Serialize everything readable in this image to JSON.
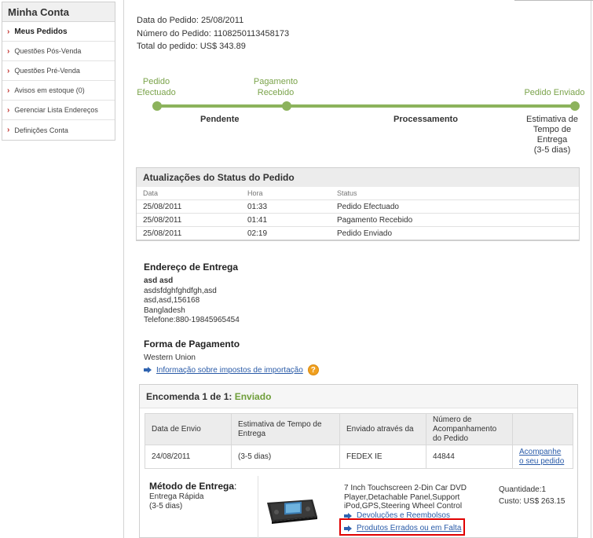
{
  "sidebar": {
    "title": "Minha Conta",
    "items": [
      {
        "label": "Meus Pedidos"
      },
      {
        "label": "Questões Pós-Venda"
      },
      {
        "label": "Questões Pré-Venda"
      },
      {
        "label": "Avisos em estoque (0)"
      },
      {
        "label": "Gerenciar Lista Endereços"
      },
      {
        "label": "Definições Conta"
      }
    ]
  },
  "order": {
    "date_line": "Data do Pedido: 25/08/2011",
    "number_line": "Número do Pedido: 1108250113458173",
    "total_line": "Total do pedido: US$ 343.89"
  },
  "progress": {
    "step1": [
      "Pedido",
      "Efectuado"
    ],
    "step2": [
      "Pagamento",
      "Recebido"
    ],
    "step3": "Pedido Enviado",
    "phase1": "Pendente",
    "phase2": "Processamento",
    "estimate": [
      "Estimativa de",
      "Tempo de",
      "Entrega",
      "(3-5 dias)"
    ],
    "colors": {
      "accent": "#8cb35c",
      "text": "#7aa34a"
    }
  },
  "status_updates": {
    "title": "Atualizações do Status do Pedido",
    "headers": [
      "Data",
      "Hora",
      "Status"
    ],
    "rows": [
      [
        "25/08/2011",
        "01:33",
        "Pedido Efectuado"
      ],
      [
        "25/08/2011",
        "01:41",
        "Pagamento Recebido"
      ],
      [
        "25/08/2011",
        "02:19",
        "Pedido Enviado"
      ]
    ]
  },
  "address": {
    "title": "Endereço de Entrega",
    "name": "asd asd",
    "lines": [
      "asdsfdghfghdfgh,asd",
      "asd,asd,156168",
      "Bangladesh",
      "Telefone:880-19845965454"
    ]
  },
  "payment": {
    "title": "Forma de Pagamento",
    "method": "Western Union",
    "import_link": "Informação sobre impostos de importação",
    "help_icon": "?"
  },
  "shipment": {
    "title_prefix": "Encomenda 1 de 1:",
    "title_status": "Enviado",
    "headers": [
      "Data de Envio",
      "Estimativa de Tempo de Entrega",
      "Enviado através da",
      "Número de Acompanhamento do Pedido",
      ""
    ],
    "row": [
      "24/08/2011",
      "(3-5 dias)",
      "FEDEX IE",
      "44844"
    ],
    "track_link": "Acompanhe o seu pedido",
    "method_title": "Método de Entrega",
    "method_colon": ":",
    "method_lines": [
      "Entrega Rápida",
      "(3-5 dias)"
    ],
    "product_name": "7 Inch Touchscreen 2-Din Car DVD Player,Detachable Panel,Support iPod,GPS,Steering Wheel Control",
    "quantity": "Quantidade:1",
    "cost": "Custo: US$ 263.15",
    "returns_link": "Devoluções e Reembolsos",
    "wrong_products_link": "Produtos Errados ou em Falta"
  }
}
